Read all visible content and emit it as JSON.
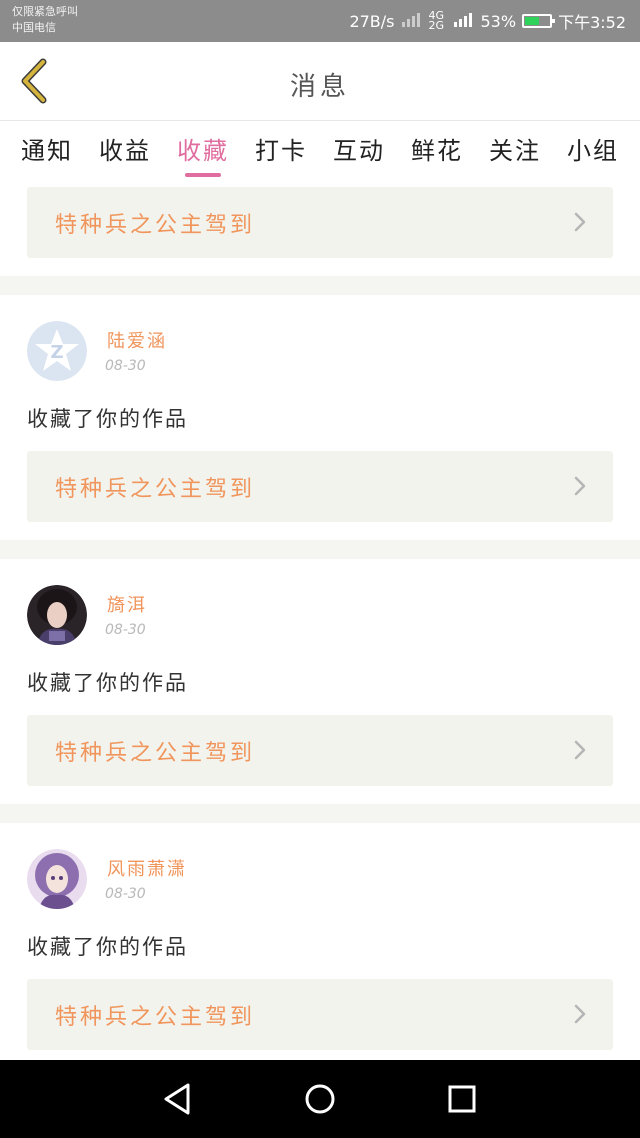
{
  "status_bar": {
    "carrier_line1": "仅限紧急呼叫",
    "carrier_line2": "中国电信",
    "net_speed": "27B/s",
    "network": "4G 2G",
    "battery": "53%",
    "time": "下午3:52"
  },
  "header": {
    "title": "消息"
  },
  "tabs": [
    {
      "label": "通知",
      "active": false
    },
    {
      "label": "收益",
      "active": false
    },
    {
      "label": "收藏",
      "active": true
    },
    {
      "label": "打卡",
      "active": false
    },
    {
      "label": "互动",
      "active": false
    },
    {
      "label": "鲜花",
      "active": false
    },
    {
      "label": "关注",
      "active": false
    },
    {
      "label": "小组",
      "active": false
    }
  ],
  "first_card": {
    "work_title": "特种兵之公主驾到"
  },
  "items": [
    {
      "user": "陆爱涵",
      "date": "08-30",
      "message": "收藏了你的作品",
      "work_title": "特种兵之公主驾到",
      "avatar": "default-qzone-avatar"
    },
    {
      "user": "旖洱",
      "date": "08-30",
      "message": "收藏了你的作品",
      "work_title": "特种兵之公主驾到",
      "avatar": "photo-avatar-dark-hair"
    },
    {
      "user": "风雨萧潇",
      "date": "08-30",
      "message": "收藏了你的作品",
      "work_title": "特种兵之公主驾到",
      "avatar": "anime-avatar-purple"
    }
  ],
  "colors": {
    "accent": "#e06d9f",
    "work_text": "#f0955b",
    "work_bg": "#f3f3ee",
    "back_arrow": "#d4b43c"
  }
}
